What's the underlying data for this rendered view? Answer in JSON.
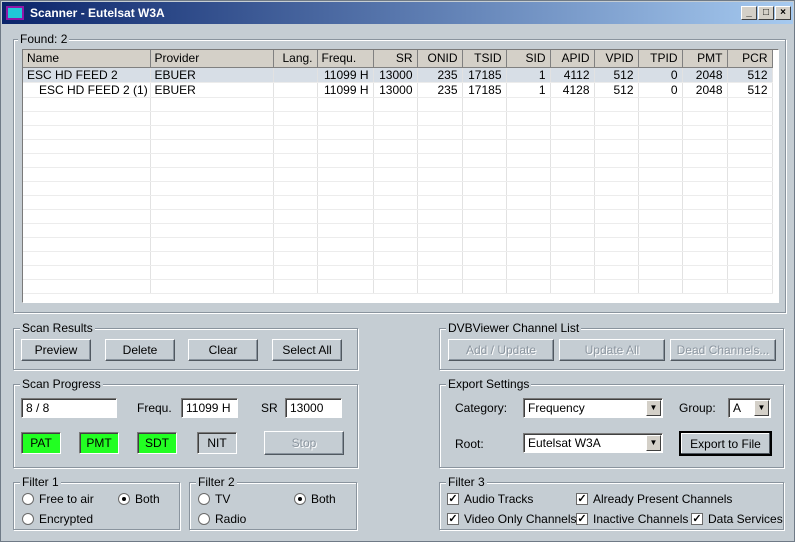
{
  "window": {
    "title": "Scanner - Eutelsat W3A",
    "minimize_glyph": "_",
    "maximize_glyph": "□",
    "close_glyph": "×"
  },
  "found": {
    "label": "Found:",
    "count": "2"
  },
  "channel_table": {
    "columns": [
      "Name",
      "Provider",
      "Lang.",
      "Frequ.",
      "SR",
      "ONID",
      "TSID",
      "SID",
      "APID",
      "VPID",
      "TPID",
      "PMT",
      "PCR"
    ],
    "rows": [
      [
        "ESC HD FEED 2",
        "EBUER",
        "",
        "11099 H",
        "13000",
        "235",
        "17185",
        "1",
        "4112",
        "512",
        "0",
        "2048",
        "512"
      ],
      [
        "ESC HD FEED 2 (1)",
        "EBUER",
        "",
        "11099 H",
        "13000",
        "235",
        "17185",
        "1",
        "4128",
        "512",
        "0",
        "2048",
        "512"
      ]
    ]
  },
  "scan_results": {
    "title": "Scan Results",
    "preview": "Preview",
    "delete": "Delete",
    "clear": "Clear",
    "select_all": "Select All"
  },
  "channel_list": {
    "title": "DVBViewer Channel List",
    "add_update": "Add / Update",
    "update_all": "Update All",
    "dead_channels": "Dead Channels..."
  },
  "scan_progress": {
    "title": "Scan Progress",
    "progress_value": "8 / 8",
    "frequ_label": "Frequ.",
    "frequ_value": "11099 H",
    "sr_label": "SR",
    "sr_value": "13000",
    "indicators": {
      "pat": "PAT",
      "pmt": "PMT",
      "sdt": "SDT",
      "nit": "NIT"
    },
    "stop": "Stop"
  },
  "export_settings": {
    "title": "Export Settings",
    "category_label": "Category:",
    "category_value": "Frequency",
    "group_label": "Group:",
    "group_value": "A",
    "root_label": "Root:",
    "root_value": "Eutelsat W3A",
    "export_button": "Export to File"
  },
  "filter1": {
    "title": "Filter 1",
    "free_to_air": "Free to air",
    "both": "Both",
    "encrypted": "Encrypted",
    "selected": "Both"
  },
  "filter2": {
    "title": "Filter 2",
    "tv": "TV",
    "both": "Both",
    "radio": "Radio",
    "selected": "Both"
  },
  "filter3": {
    "title": "Filter 3",
    "audio_tracks": "Audio Tracks",
    "already_present": "Already Present Channels",
    "video_only": "Video Only Channels",
    "inactive": "Inactive Channels",
    "data_services": "Data Services",
    "all_checked": true
  },
  "colors": {
    "indicator_active": "#22ff22",
    "window_bg": "#c5cdd3",
    "titlebar_start": "#0a246a",
    "titlebar_end": "#a6caf0"
  }
}
